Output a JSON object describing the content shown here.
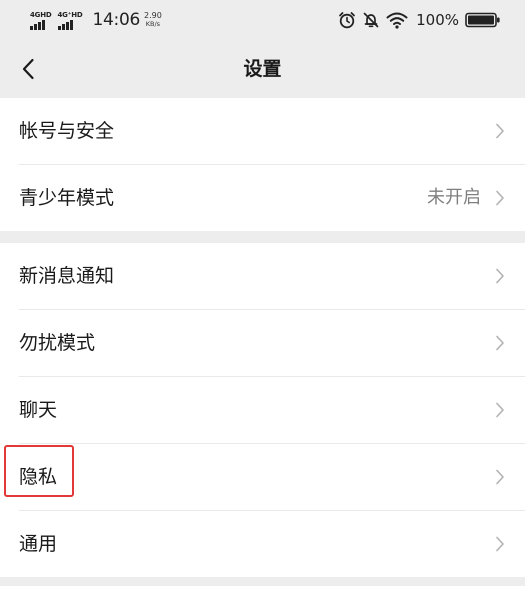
{
  "status_bar": {
    "sim1_label": "4GHD",
    "sim2_label": "4G⁺HD",
    "time": "14:06",
    "speed_value": "2.90",
    "speed_unit": "KB/s",
    "alarm_icon": "alarm-clock-icon",
    "mute_icon": "bell-off-icon",
    "wifi_icon": "wifi-icon",
    "battery_percent": "100%",
    "battery_level": 1.0
  },
  "nav": {
    "title": "设置",
    "back_icon": "chevron-left-icon"
  },
  "settings": {
    "group1": [
      {
        "label": "帐号与安全",
        "value": ""
      },
      {
        "label": "青少年模式",
        "value": "未开启"
      }
    ],
    "group2": [
      {
        "label": "新消息通知",
        "value": ""
      },
      {
        "label": "勿扰模式",
        "value": ""
      },
      {
        "label": "聊天",
        "value": ""
      },
      {
        "label": "隐私",
        "value": ""
      },
      {
        "label": "通用",
        "value": ""
      }
    ]
  },
  "colors": {
    "background": "#ededed",
    "row_background": "#ffffff",
    "text_primary": "#1a1a1a",
    "text_secondary": "#7f7f7f",
    "chevron": "#b2b2b2",
    "highlight": "#e23838"
  }
}
